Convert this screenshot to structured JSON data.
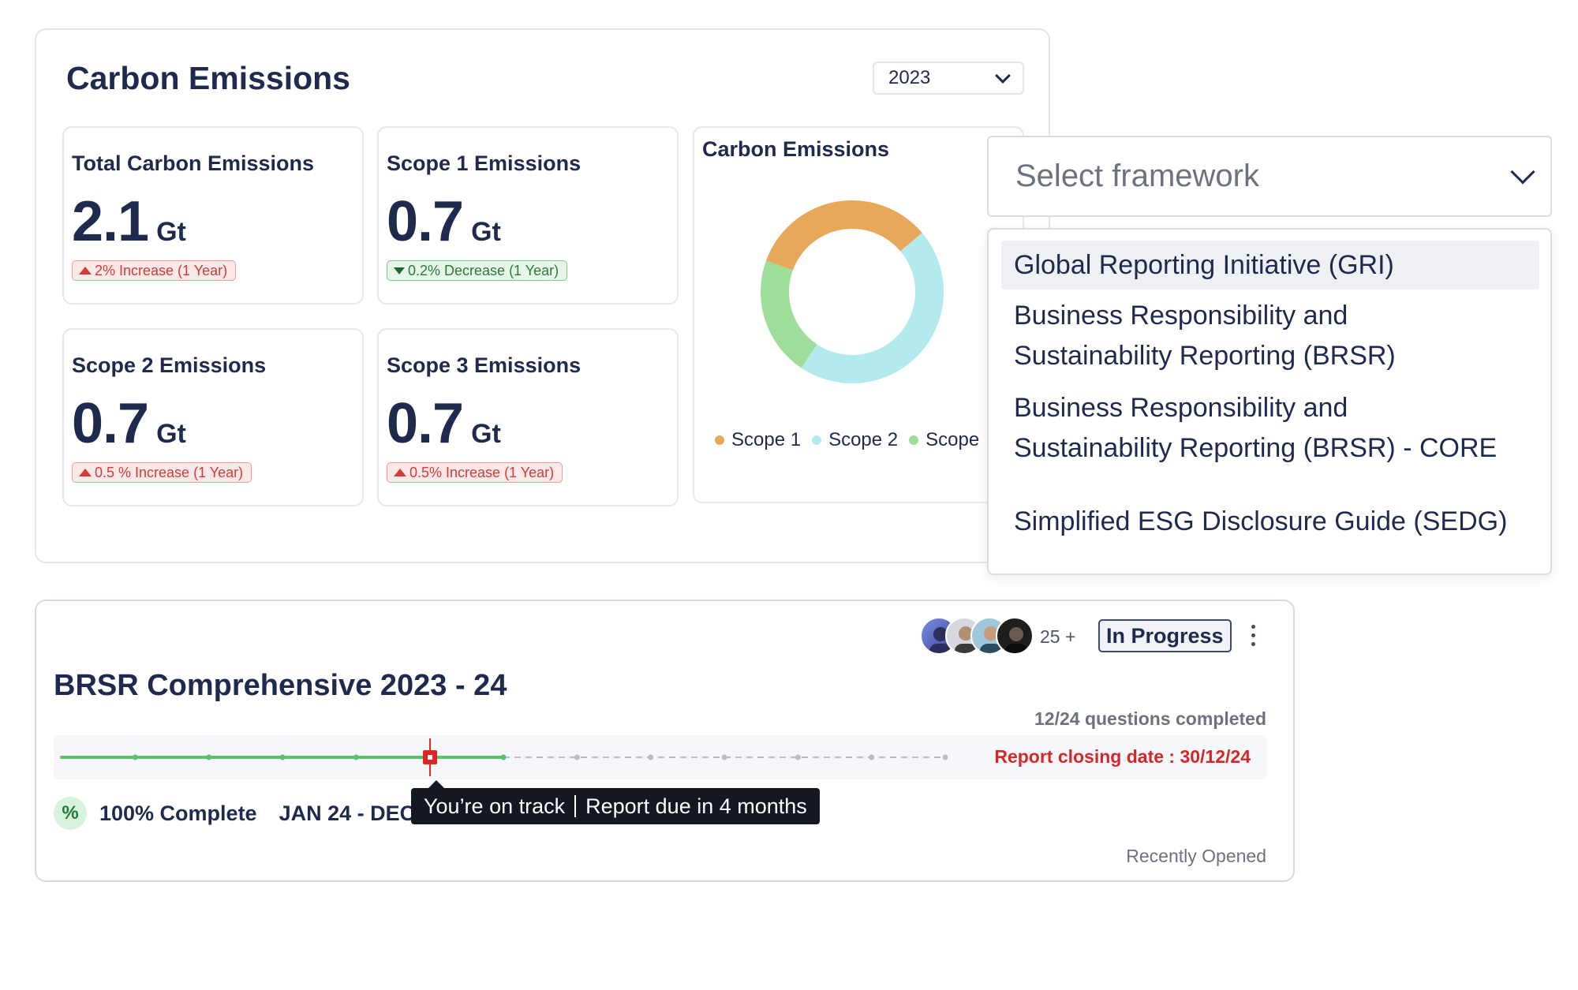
{
  "carbon": {
    "title": "Carbon Emissions",
    "year": "2023",
    "metrics": [
      {
        "label": "Total Carbon Emissions",
        "value": "2.1",
        "unit": "Gt",
        "change": "2% Increase (1 Year)",
        "direction": "up"
      },
      {
        "label": "Scope 1 Emissions",
        "value": "0.7",
        "unit": "Gt",
        "change": "0.2% Decrease (1 Year)",
        "direction": "down"
      },
      {
        "label": "Scope 2 Emissions",
        "value": "0.7",
        "unit": "Gt",
        "change": "0.5 % Increase (1 Year)",
        "direction": "up"
      },
      {
        "label": "Scope 3 Emissions",
        "value": "0.7",
        "unit": "Gt",
        "change": "0.5% Increase (1 Year)",
        "direction": "up"
      }
    ],
    "donut": {
      "title": "Carbon Emissions",
      "legend": [
        "Scope 1",
        "Scope 2",
        "Scope"
      ]
    }
  },
  "chart_data": {
    "type": "pie",
    "title": "Carbon Emissions",
    "categories": [
      "Scope 1",
      "Scope 2",
      "Scope 3"
    ],
    "values": [
      33.3,
      45.5,
      21.2
    ],
    "colors": [
      "#e8a85a",
      "#b3eaee",
      "#9fdd9b"
    ]
  },
  "framework": {
    "placeholder": "Select framework",
    "options": [
      {
        "line1": "Global Reporting Initiative (GRI)",
        "line2": ""
      },
      {
        "line1": "Business Responsibility and",
        "line2": "Sustainability Reporting (BRSR)"
      },
      {
        "line1": "Business Responsibility and",
        "line2": "Sustainability Reporting (BRSR) - CORE"
      },
      {
        "line1": "Simplified ESG Disclosure Guide (SEDG)",
        "line2": ""
      }
    ],
    "active_index": 0
  },
  "brsr": {
    "title": "BRSR Comprehensive 2023 - 24",
    "avatar_count": "25 +",
    "status": "In Progress",
    "questions": "12/24 questions completed",
    "closing": "Report closing date : 30/12/24",
    "progress": 0.5,
    "current_marker": 0.417,
    "complete": "100% Complete",
    "pct_symbol": "%",
    "date_range": "JAN 24 - DEC",
    "tooltip_left": "You’re on track",
    "tooltip_right": "Report due in 4 months",
    "recently_opened": "Recently Opened"
  },
  "colors": {
    "navy": "#1f2a4f",
    "increase_red": "#d03b3b",
    "decrease_green": "#2b7a3a",
    "track_green": "#5cc26a",
    "marker_red": "#e02424"
  }
}
